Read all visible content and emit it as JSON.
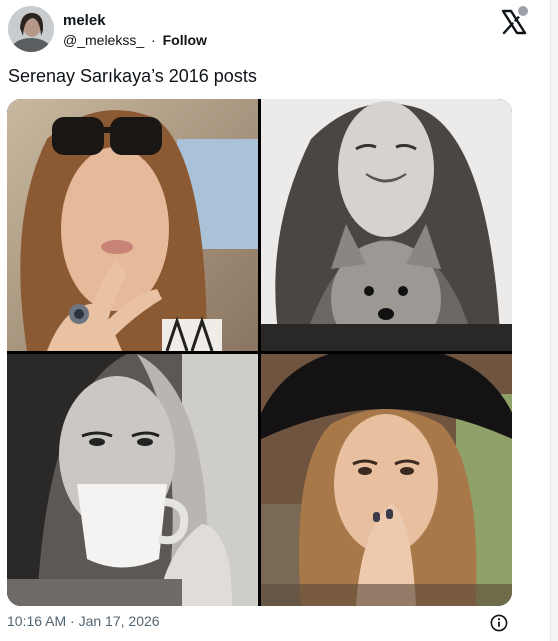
{
  "author": {
    "name": "melek",
    "handle": "@_melekss_",
    "separator": "·",
    "follow_label": "Follow",
    "avatar_icon": "profile-avatar"
  },
  "brand": {
    "logo_icon": "x-logo-icon"
  },
  "tweet": {
    "text": "Serenay Sarıkaya’s 2016 posts",
    "timestamp": "10:16 AM · Jan 17, 2026"
  },
  "media": {
    "count": 4,
    "photos": [
      {
        "name": "photo-selfie-sunglasses",
        "palette": "color"
      },
      {
        "name": "photo-with-dog",
        "palette": "grayscale"
      },
      {
        "name": "photo-coffee-cup",
        "palette": "grayscale"
      },
      {
        "name": "photo-black-hat",
        "palette": "color"
      }
    ]
  },
  "footer": {
    "info_icon": "info-icon"
  },
  "colors": {
    "text": "#0f1419",
    "muted": "#536471"
  }
}
